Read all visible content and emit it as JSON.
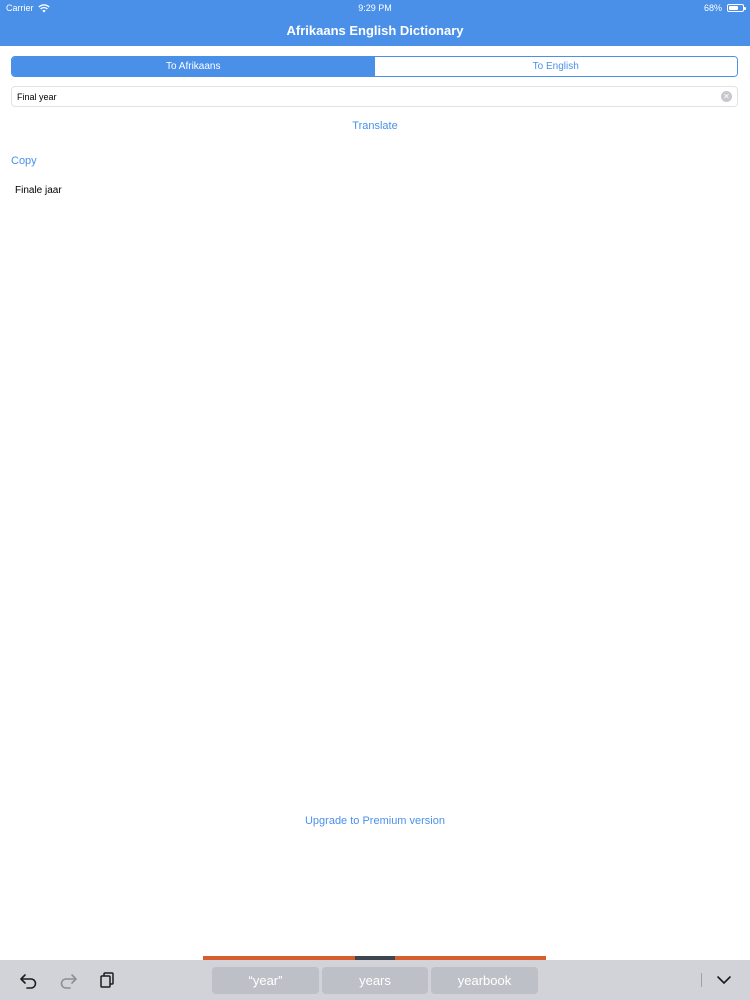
{
  "status_bar": {
    "carrier": "Carrier",
    "time": "9:29 PM",
    "battery_percent": "68%",
    "battery_level": 0.68
  },
  "nav": {
    "title": "Afrikaans English Dictionary"
  },
  "segments": [
    {
      "label": "To Afrikaans",
      "selected": true
    },
    {
      "label": "To English",
      "selected": false
    }
  ],
  "search": {
    "value": "Final year",
    "clear_icon": "clear-circle-icon"
  },
  "actions": {
    "translate": "Translate",
    "copy": "Copy",
    "upgrade": "Upgrade to Premium version"
  },
  "result": {
    "text": "Finale jaar"
  },
  "keyboard": {
    "suggestions": [
      "“year”",
      "years",
      "yearbook"
    ],
    "icons": [
      "undo-icon",
      "redo-icon",
      "paste-icon",
      "dismiss-keyboard-icon"
    ]
  },
  "colors": {
    "accent": "#4a90e9",
    "keyboard_bar": "#d1d3d9",
    "suggestion_bg": "#bdc0c7",
    "accent_strip": "#d55f2e"
  }
}
